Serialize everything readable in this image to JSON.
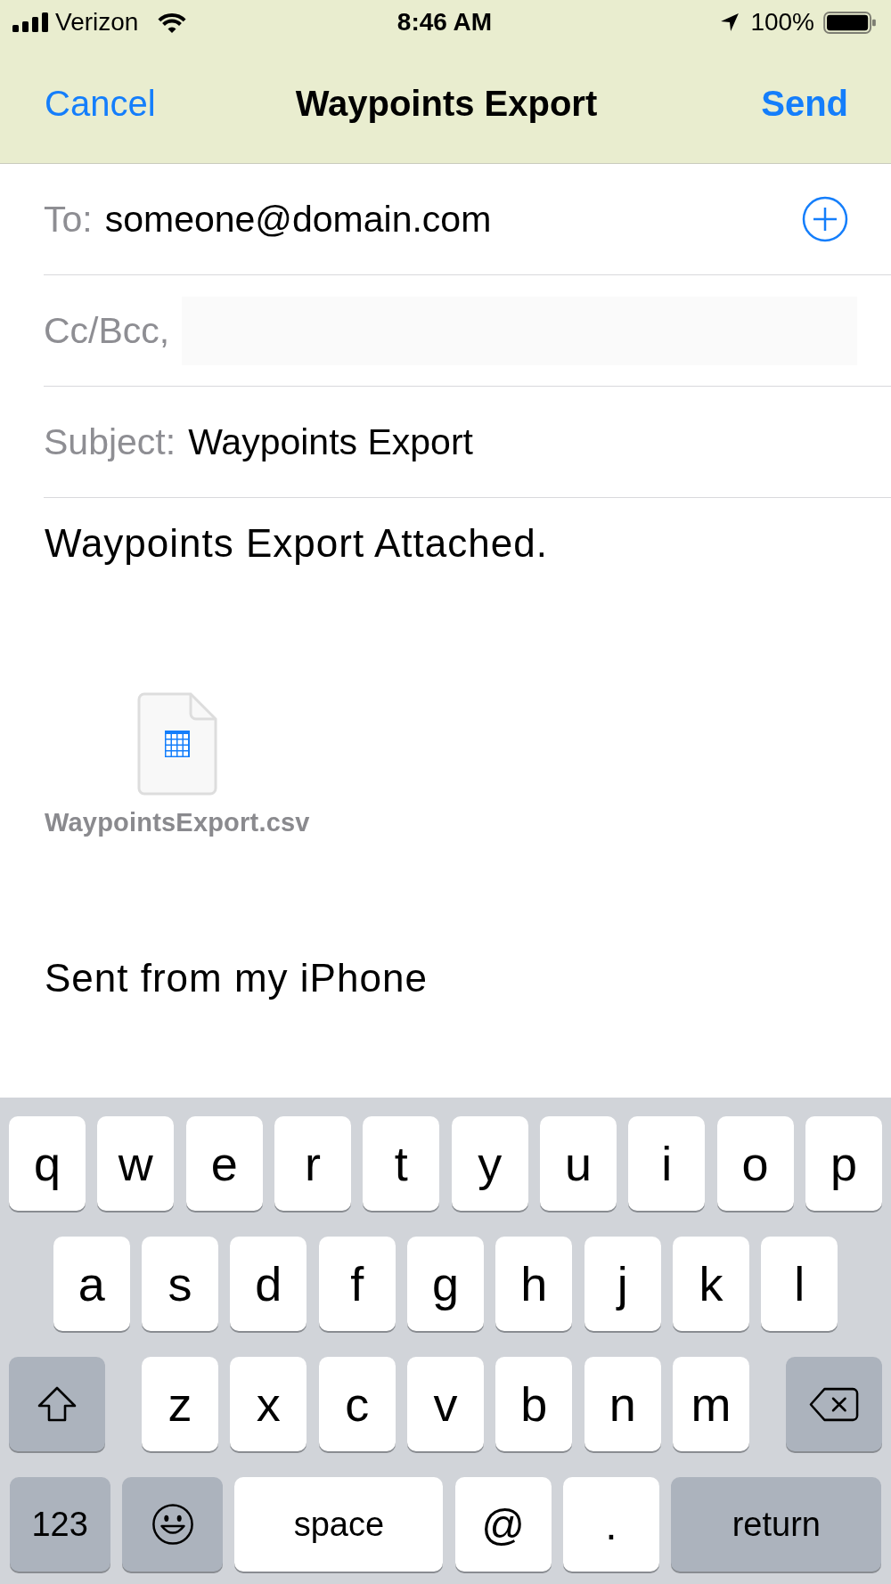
{
  "status_bar": {
    "carrier": "Verizon",
    "time": "8:46 AM",
    "battery": "100%"
  },
  "nav_bar": {
    "cancel": "Cancel",
    "title": "Waypoints Export",
    "send": "Send"
  },
  "fields": [
    {
      "kind": "recipient",
      "label": "To:",
      "value": "someone@domain.com"
    },
    {
      "kind": "blank",
      "label": "Cc/Bcc,"
    },
    {
      "kind": "text",
      "label": "Subject:",
      "value": "Waypoints Export"
    }
  ],
  "message": {
    "text": "Waypoints Export Attached.",
    "attachment": {
      "filename": "WaypointsExport.csv"
    },
    "signature": "Sent from my iPhone"
  },
  "keyboard": {
    "row_1": [
      "q",
      "w",
      "e",
      "r",
      "t",
      "y",
      "u",
      "i",
      "o",
      "p"
    ],
    "row_2": [
      "a",
      "s",
      "d",
      "f",
      "g",
      "h",
      "j",
      "k",
      "l"
    ],
    "row_3": [
      "z",
      "x",
      "c",
      "v",
      "b",
      "n",
      "m"
    ],
    "bottom_row": {
      "numbers_key": "123",
      "space_key": "space",
      "at_key": "@",
      "period_key": ".",
      "return_key": "return"
    }
  }
}
